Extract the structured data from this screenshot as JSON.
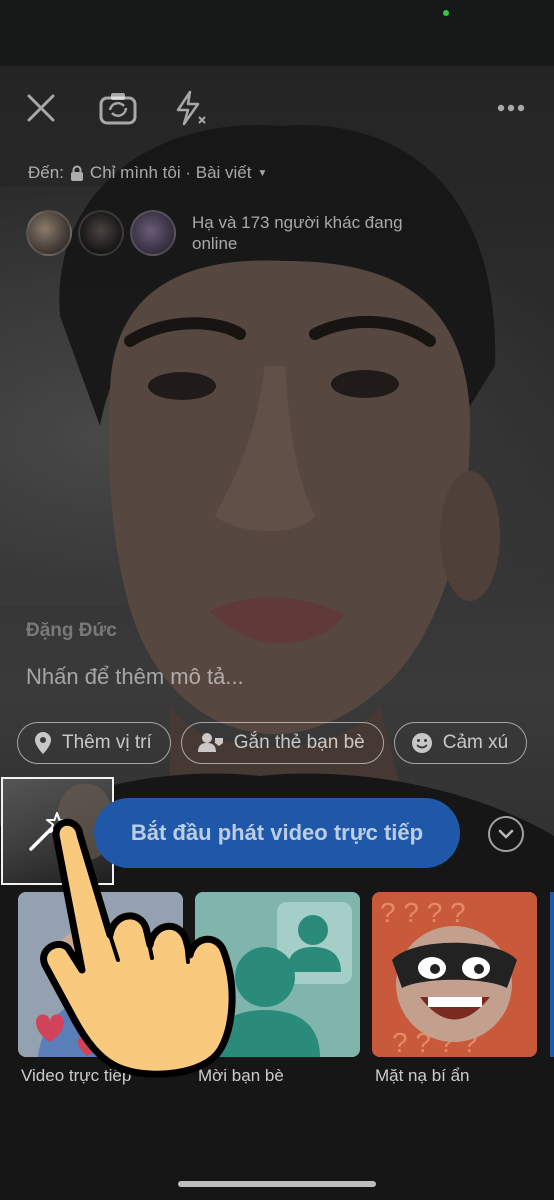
{
  "audience": {
    "prefix": "Đến:",
    "value": "Chỉ mình tôi · Bài viết"
  },
  "online": {
    "text": "Hạ và 173 người khác đang online"
  },
  "author": {
    "name": "Đặng Đức"
  },
  "description": {
    "placeholder": "Nhấn để thêm mô tả..."
  },
  "chips": [
    {
      "label": "Thêm vị trí",
      "icon": "location-pin-icon"
    },
    {
      "label": "Gắn thẻ bạn bè",
      "icon": "tag-friends-icon"
    },
    {
      "label": "Cảm xú",
      "icon": "emoji-icon"
    }
  ],
  "live": {
    "button_label": "Bắt đầu phát video trực tiếp"
  },
  "cards": [
    {
      "label": "Video trực tiếp"
    },
    {
      "label": "Mời bạn bè"
    },
    {
      "label": "Mặt nạ bí ẩn"
    }
  ],
  "icons": {
    "close": "close-icon",
    "flip_camera": "flip-camera-icon",
    "flash": "flash-off-icon",
    "more": "more-options-icon",
    "effects": "magic-wand-icon",
    "chevron": "chevron-down-icon",
    "hand": "tap-hand-icon",
    "lock": "lock-icon"
  },
  "colors": {
    "button": "#1f58a8",
    "status_dot": "#2ecc40",
    "hand": "#f9c97e"
  }
}
